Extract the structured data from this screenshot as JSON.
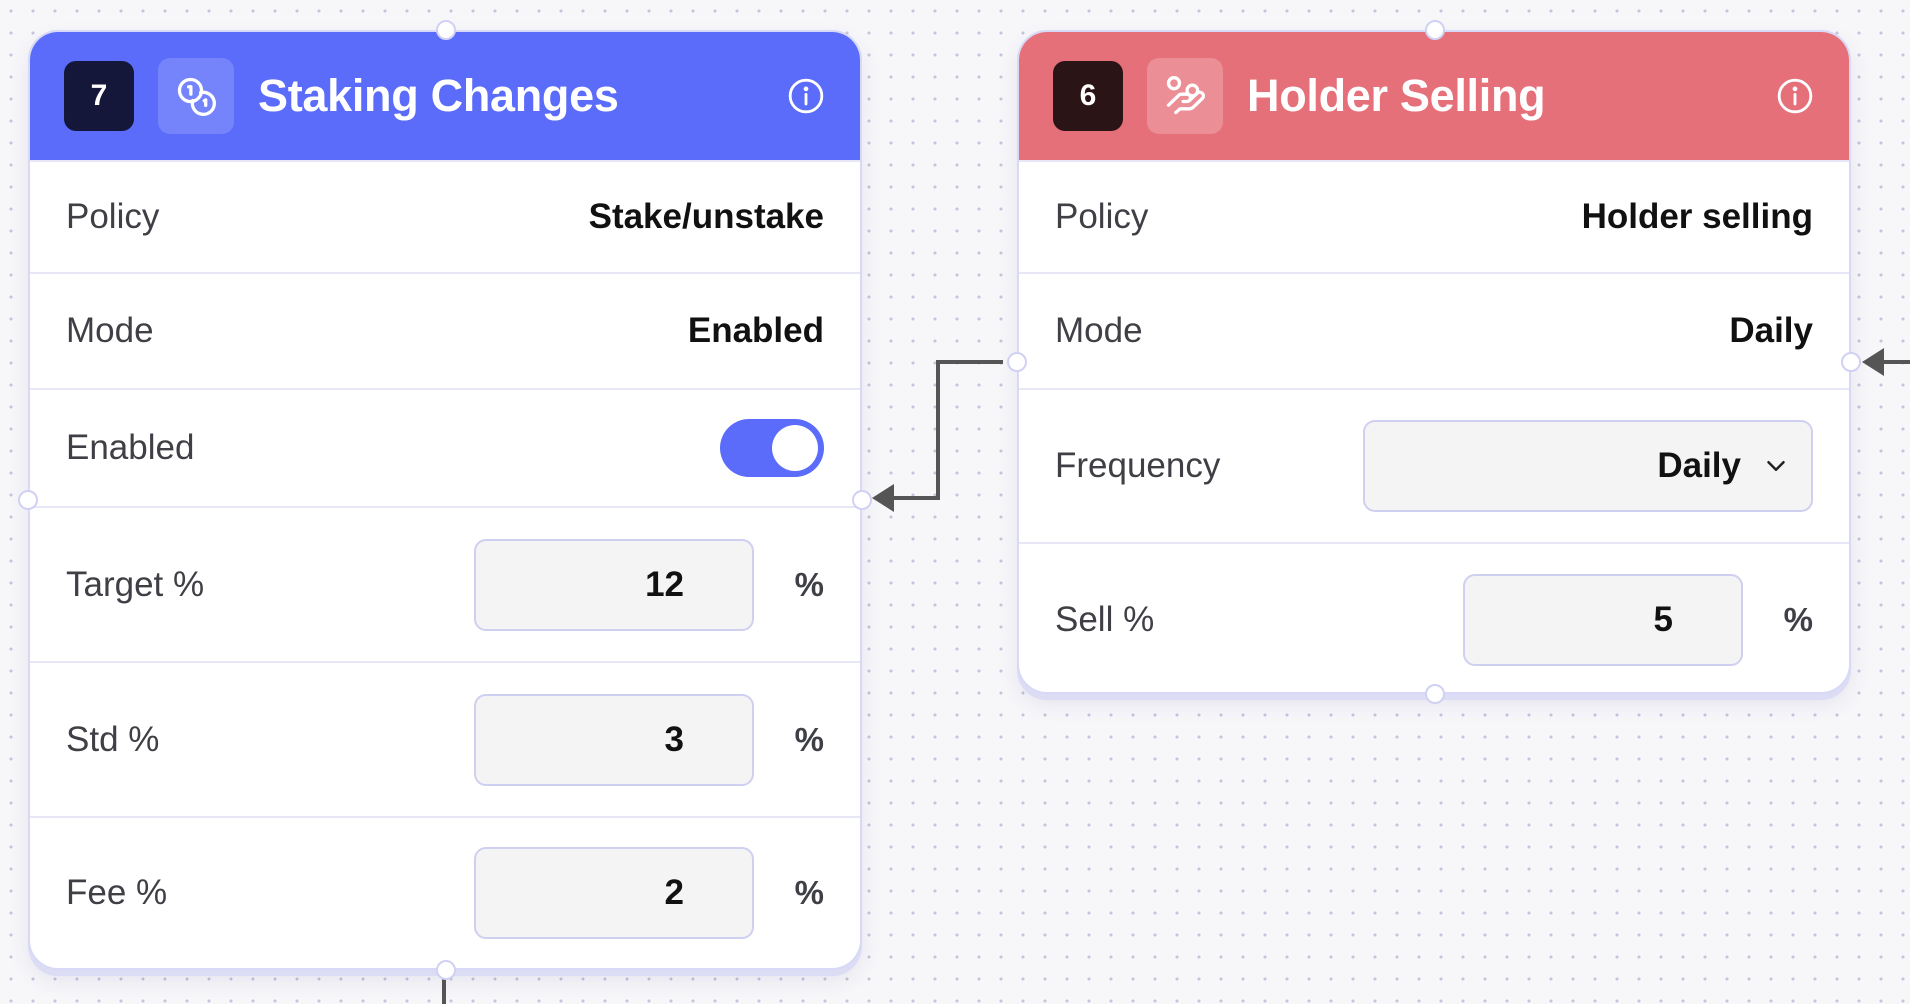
{
  "nodes": {
    "staking": {
      "badge": "7",
      "title": "Staking Changes",
      "icon": "coins-icon",
      "accent": "#5a6cf9",
      "policy_label": "Policy",
      "policy_value": "Stake/unstake",
      "mode_label": "Mode",
      "mode_value": "Enabled",
      "enabled_label": "Enabled",
      "enabled_on": true,
      "target_label": "Target %",
      "target_value": "12",
      "std_label": "Std %",
      "std_value": "3",
      "fee_label": "Fee %",
      "fee_value": "2",
      "unit": "%"
    },
    "holder": {
      "badge": "6",
      "title": "Holder Selling",
      "icon": "hand-coins-icon",
      "accent": "#e5707a",
      "policy_label": "Policy",
      "policy_value": "Holder selling",
      "mode_label": "Mode",
      "mode_value": "Daily",
      "frequency_label": "Frequency",
      "frequency_value": "Daily",
      "sell_label": "Sell %",
      "sell_value": "5",
      "unit": "%"
    }
  }
}
